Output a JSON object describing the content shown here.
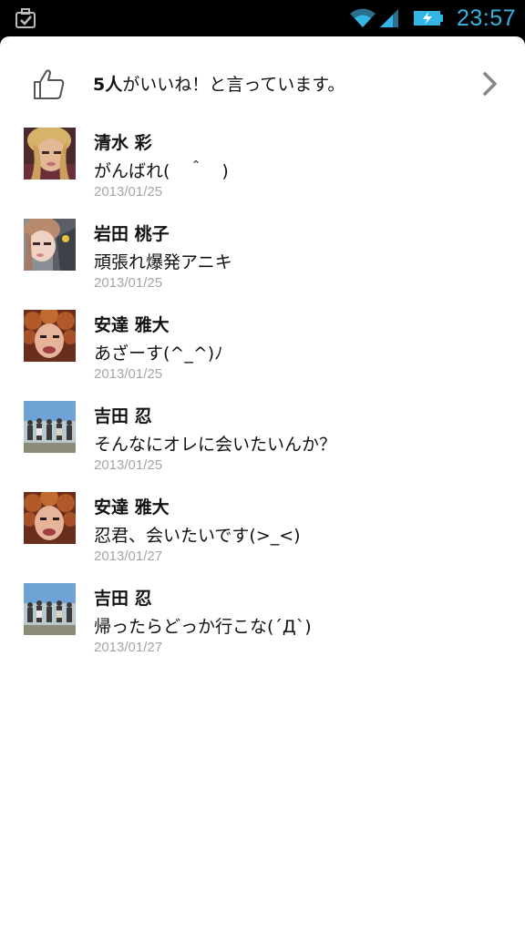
{
  "status_bar": {
    "time": "23:57",
    "accent_color": "#33b5e5",
    "icons": [
      "notification-checkmark-icon",
      "wifi-icon",
      "signal-icon",
      "battery-charging-icon"
    ]
  },
  "likes": {
    "count": "5人",
    "suffix": "がいいね！と言っています。",
    "icon": "thumbs-up-icon"
  },
  "comments": [
    {
      "name": "清水 彩",
      "text": "がんばれ(　＾　)",
      "date": "2013/01/25",
      "avatar": "blonde-selfie"
    },
    {
      "name": "岩田 桃子",
      "text": "頑張れ爆発アニキ",
      "date": "2013/01/25",
      "avatar": "pink-selfie"
    },
    {
      "name": "安達 雅大",
      "text": "あざーす(^_^)ﾉ",
      "date": "2013/01/25",
      "avatar": "curly-hair-face"
    },
    {
      "name": "吉田 忍",
      "text": "そんなにオレに会いたいんか？",
      "date": "2013/01/25",
      "avatar": "group-beach-photo"
    },
    {
      "name": "安達 雅大",
      "text": "忍君、会いたいです(>_<)",
      "date": "2013/01/27",
      "avatar": "curly-hair-face"
    },
    {
      "name": "吉田 忍",
      "text": "帰ったらどっか行こな(´Д`)",
      "date": "2013/01/27",
      "avatar": "group-beach-photo"
    }
  ]
}
